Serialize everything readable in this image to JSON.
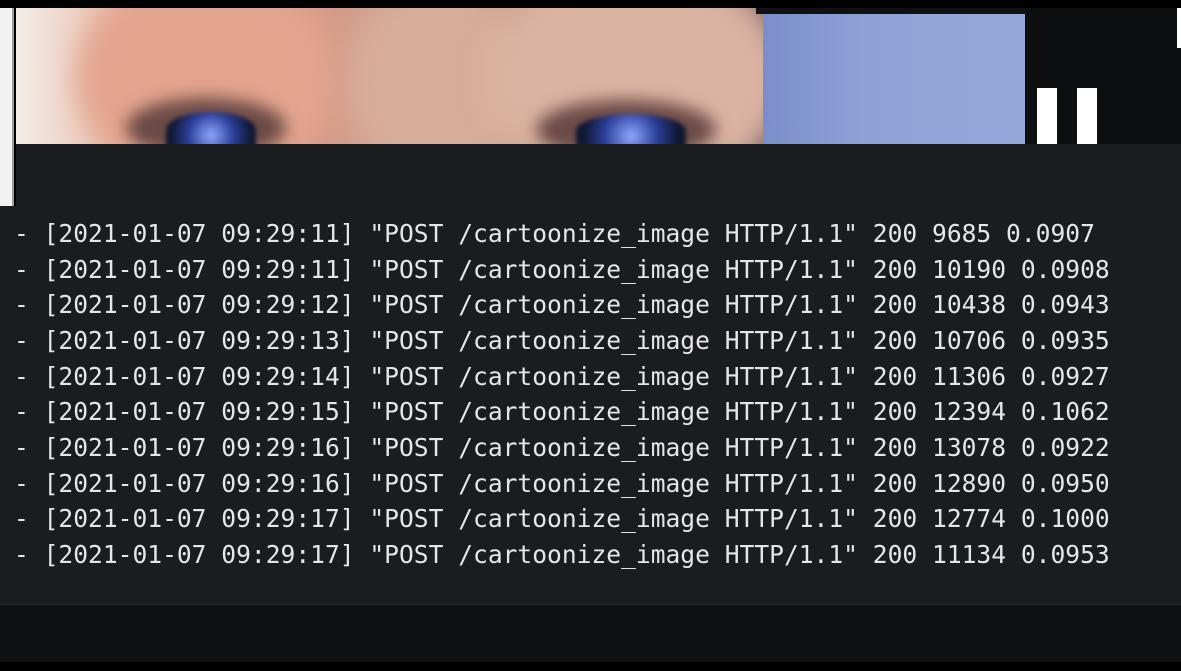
{
  "webcam": {
    "description_icon": "webcam-feed"
  },
  "controls": {
    "pause_icon": "pause-icon"
  },
  "log": {
    "lines": [
      "- [2021-01-07 09:29:11] \"POST /cartoonize_image HTTP/1.1\" 200 9685 0.0907",
      "- [2021-01-07 09:29:11] \"POST /cartoonize_image HTTP/1.1\" 200 10190 0.0908",
      "- [2021-01-07 09:29:12] \"POST /cartoonize_image HTTP/1.1\" 200 10438 0.0943",
      "- [2021-01-07 09:29:13] \"POST /cartoonize_image HTTP/1.1\" 200 10706 0.0935",
      "- [2021-01-07 09:29:14] \"POST /cartoonize_image HTTP/1.1\" 200 11306 0.0927",
      "- [2021-01-07 09:29:15] \"POST /cartoonize_image HTTP/1.1\" 200 12394 0.1062",
      "- [2021-01-07 09:29:16] \"POST /cartoonize_image HTTP/1.1\" 200 13078 0.0922",
      "- [2021-01-07 09:29:16] \"POST /cartoonize_image HTTP/1.1\" 200 12890 0.0950",
      "- [2021-01-07 09:29:17] \"POST /cartoonize_image HTTP/1.1\" 200 12774 0.1000",
      "- [2021-01-07 09:29:17] \"POST /cartoonize_image HTTP/1.1\" 200 11134 0.0953"
    ]
  }
}
